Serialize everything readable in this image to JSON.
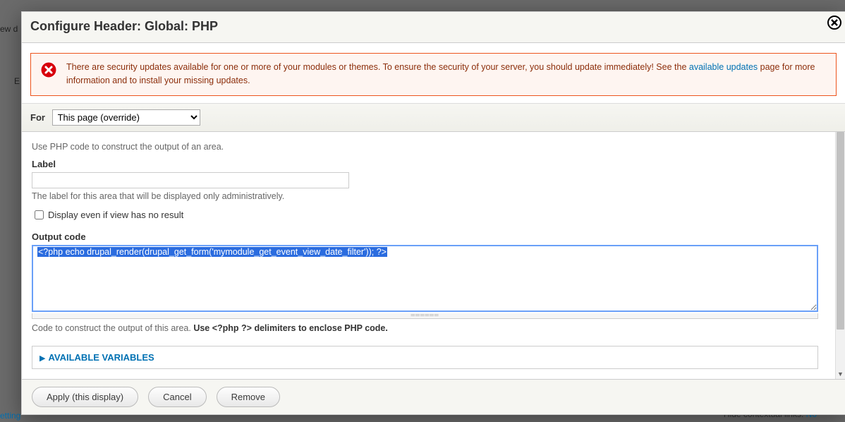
{
  "bg": {
    "frag_a": "ew d",
    "frag_b": "E",
    "frag_c": "etting",
    "frag_d_prefix": "Hide contextual links: ",
    "frag_d_link": "No"
  },
  "modal": {
    "title": "Configure Header: Global: PHP"
  },
  "message": {
    "text_before": "There are security updates available for one or more of your modules or themes. To ensure the security of your server, you should update immediately! See the ",
    "link": "available updates",
    "text_after": " page for more information and to install your missing updates."
  },
  "for_bar": {
    "label": "For",
    "selected": "This page (override)"
  },
  "form": {
    "intro": "Use PHP code to construct the output of an area.",
    "label_label": "Label",
    "label_value": "",
    "label_help": "The label for this area that will be displayed only administratively.",
    "checkbox_label": "Display even if view has no result",
    "checkbox_checked": false,
    "output_label": "Output code",
    "output_value": "<?php echo drupal_render(drupal_get_form('mymodule_get_event_view_date_filter')); ?>",
    "output_help_plain": "Code to construct the output of this area. ",
    "output_help_bold": "Use <?php ?> delimiters to enclose PHP code."
  },
  "fieldset": {
    "label": "AVAILABLE VARIABLES"
  },
  "buttons": {
    "apply": "Apply (this display)",
    "cancel": "Cancel",
    "remove": "Remove"
  }
}
